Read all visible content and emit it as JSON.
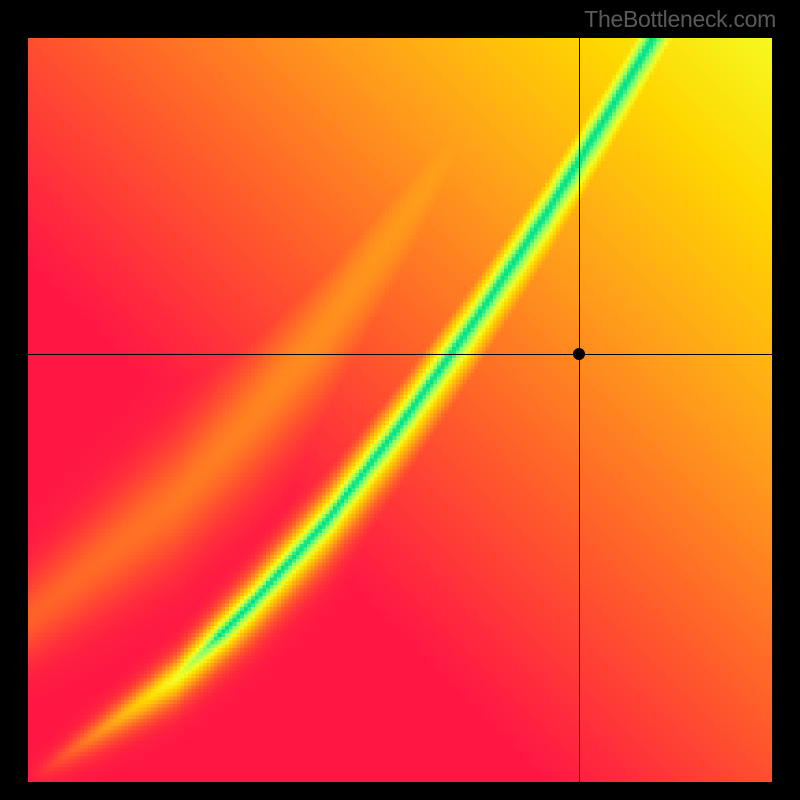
{
  "watermark": "TheBottleneck.com",
  "chart_data": {
    "type": "heatmap",
    "title": "",
    "xlabel": "",
    "ylabel": "",
    "xlim": [
      0,
      1
    ],
    "ylim": [
      0,
      1
    ],
    "grid": false,
    "legend": false,
    "marker": {
      "x": 0.74,
      "y": 0.575
    },
    "crosshairs": {
      "x": 0.74,
      "y": 0.575
    },
    "colormap": [
      {
        "t": 0.0,
        "hex": "#ff1744"
      },
      {
        "t": 0.2,
        "hex": "#ff5a2b"
      },
      {
        "t": 0.4,
        "hex": "#ff9f1a"
      },
      {
        "t": 0.58,
        "hex": "#ffd600"
      },
      {
        "t": 0.74,
        "hex": "#f4ff26"
      },
      {
        "t": 0.9,
        "hex": "#8fff6a"
      },
      {
        "t": 1.0,
        "hex": "#00e18b"
      }
    ],
    "optimal_curve": {
      "description": "normalized axes 0..1; y_opt(x) piecewise between (x,y) control points, representing the green ridge on the heatmap",
      "points": [
        {
          "x": 0.0,
          "y": 0.0
        },
        {
          "x": 0.1,
          "y": 0.07
        },
        {
          "x": 0.2,
          "y": 0.14
        },
        {
          "x": 0.3,
          "y": 0.24
        },
        {
          "x": 0.4,
          "y": 0.35
        },
        {
          "x": 0.5,
          "y": 0.48
        },
        {
          "x": 0.6,
          "y": 0.62
        },
        {
          "x": 0.7,
          "y": 0.77
        },
        {
          "x": 0.78,
          "y": 0.9
        },
        {
          "x": 0.84,
          "y": 1.0
        }
      ]
    },
    "ridge_width": {
      "description": "half-width of the green band along y, as a function of x (normalized)",
      "scale": 0.05,
      "growth": 0.9
    }
  },
  "canvas": {
    "resolution": 200,
    "display_size": 744
  }
}
